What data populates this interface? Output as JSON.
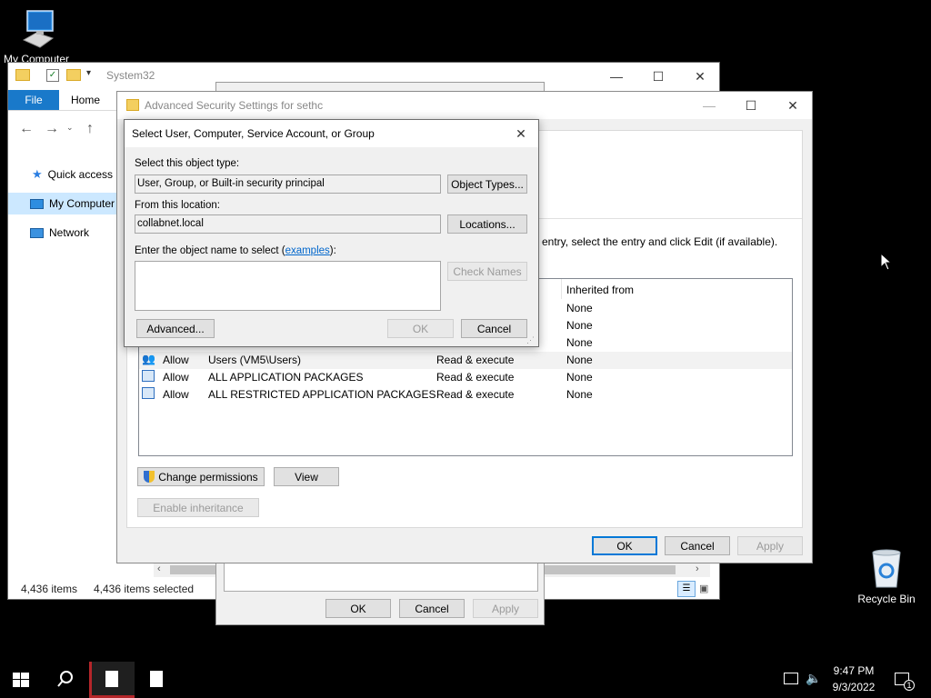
{
  "desktop": {
    "my_computer_label": "My Computer",
    "recycle_bin_label": "Recycle Bin"
  },
  "explorer": {
    "title": "System32",
    "tabs": {
      "file": "File",
      "home": "Home"
    },
    "nav": [
      {
        "label": "Quick access",
        "icon": "star-icon"
      },
      {
        "label": "My Computer",
        "icon": "computer-icon"
      },
      {
        "label": "Network",
        "icon": "network-icon"
      }
    ],
    "status_items": "4,436 items",
    "status_selected": "4,436 items selected"
  },
  "properties_dialog": {
    "ok": "OK",
    "cancel": "Cancel",
    "apply": "Apply"
  },
  "adv_security": {
    "title": "Advanced Security Settings for sethc",
    "info_text": "entry, select the entry and click Edit (if available).",
    "column_inherited": "Inherited from",
    "entries": [
      {
        "type": "",
        "principal": "",
        "access": "",
        "inherited": "None"
      },
      {
        "type": "",
        "principal": "",
        "access": "",
        "inherited": "None"
      },
      {
        "type": "",
        "principal": "",
        "access": "",
        "inherited": "None"
      },
      {
        "type": "Allow",
        "principal": "Users (VM5\\Users)",
        "access": "Read & execute",
        "inherited": "None"
      },
      {
        "type": "Allow",
        "principal": "ALL APPLICATION PACKAGES",
        "access": "Read & execute",
        "inherited": "None"
      },
      {
        "type": "Allow",
        "principal": "ALL RESTRICTED APPLICATION PACKAGES",
        "access": "Read & execute",
        "inherited": "None"
      }
    ],
    "change_permissions": "Change permissions",
    "view": "View",
    "enable_inheritance": "Enable inheritance",
    "ok": "OK",
    "cancel": "Cancel",
    "apply": "Apply"
  },
  "select_dialog": {
    "title": "Select User, Computer, Service Account, or Group",
    "object_type_label": "Select this object type:",
    "object_type_value": "User, Group, or Built-in security principal",
    "object_types_button": "Object Types...",
    "location_label": "From this location:",
    "location_value": "collabnet.local",
    "locations_button": "Locations...",
    "enter_name_label_prefix": "Enter the object name to select (",
    "examples_link": "examples",
    "enter_name_label_suffix": "):",
    "object_name_value": "",
    "check_names_button": "Check Names",
    "advanced_button": "Advanced...",
    "ok_button": "OK",
    "cancel_button": "Cancel"
  },
  "taskbar": {
    "time": "9:47 PM",
    "date": "9/3/2022",
    "notification_count": "1"
  },
  "colors": {
    "accent": "#0078d7",
    "taskbar_active": "#b5262a"
  }
}
